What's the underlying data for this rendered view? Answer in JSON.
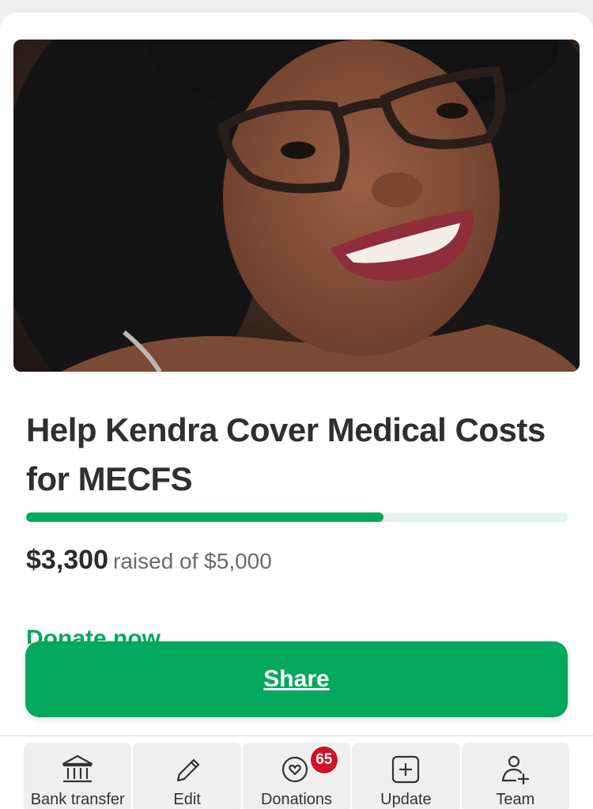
{
  "campaign": {
    "title": "Help Kendra Cover Medical Costs for MECFS",
    "progress_fraction": 0.66,
    "raised_amount": "$3,300",
    "raised_text": "raised of $5,000",
    "donate_link": "Donate now"
  },
  "share": {
    "label": "Share"
  },
  "toolbar": {
    "items": [
      {
        "label": "Bank transfer",
        "icon": "bank-icon"
      },
      {
        "label": "Edit",
        "icon": "pencil-icon"
      },
      {
        "label": "Donations",
        "icon": "heart-bubble-icon",
        "badge": "65"
      },
      {
        "label": "Update",
        "icon": "plus-square-icon"
      },
      {
        "label": "Team",
        "icon": "add-person-icon"
      }
    ]
  },
  "colors": {
    "accent": "#02a95c",
    "track": "#e4f3ec",
    "badge": "#d1102a"
  }
}
